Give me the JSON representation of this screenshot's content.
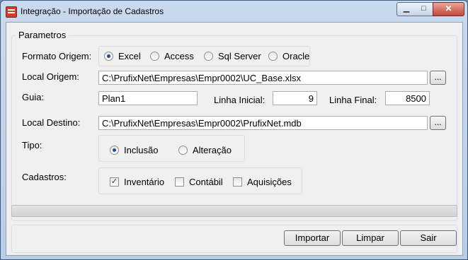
{
  "window": {
    "title": "Integração - Importação de Cadastros",
    "controls": {
      "minimize": "▁",
      "maximize": "□",
      "close": "✕"
    }
  },
  "group": {
    "legend": "Parametros"
  },
  "formato_origem": {
    "label": "Formato Origem:",
    "options": [
      "Excel",
      "Access",
      "Sql Server",
      "Oracle"
    ],
    "selected": "Excel"
  },
  "local_origem": {
    "label": "Local Origem:",
    "value": "C:\\PrufixNet\\Empresas\\Empr0002\\UC_Base.xlsx",
    "browse": "..."
  },
  "guia": {
    "label": "Guia:",
    "value": "Plan1"
  },
  "linha_inicial": {
    "label": "Linha Inicial:",
    "value": "9"
  },
  "linha_final": {
    "label": "Linha Final:",
    "value": "8500"
  },
  "local_destino": {
    "label": "Local Destino:",
    "value": "C:\\PrufixNet\\Empresas\\Empr0002\\PrufixNet.mdb",
    "browse": "..."
  },
  "tipo": {
    "label": "Tipo:",
    "options": [
      "Inclusão",
      "Alteração"
    ],
    "selected": "Inclusão"
  },
  "cadastros": {
    "label": "Cadastros:",
    "items": [
      {
        "label": "Inventário",
        "checked": true
      },
      {
        "label": "Contábil",
        "checked": false
      },
      {
        "label": "Aquisições",
        "checked": false
      }
    ]
  },
  "progress": {
    "value": 0
  },
  "buttons": {
    "importar": "Importar",
    "limpar": "Limpar",
    "sair": "Sair"
  }
}
